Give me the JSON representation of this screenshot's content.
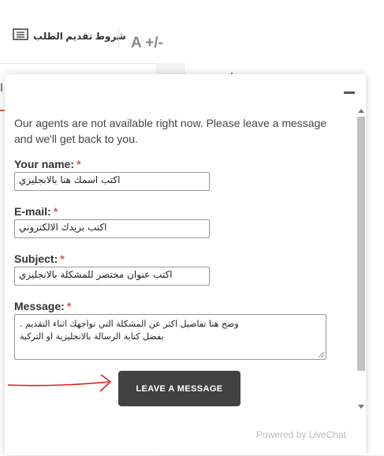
{
  "header": {
    "terms_label": "شروط تقديم الطلب",
    "font_size_label": "A +/-"
  },
  "background": {
    "left_fragment": "ا"
  },
  "chat": {
    "notice": "Our agents are not available right now. Please leave a message and we'll get back to you.",
    "fields": {
      "name": {
        "label": "Your name:",
        "required_mark": "*",
        "value": "اكتب اسمك هنا بالانجليزي"
      },
      "email": {
        "label": "E-mail:",
        "required_mark": "*",
        "value": "اكتب بريدك الالكتروني"
      },
      "subject": {
        "label": "Subject:",
        "required_mark": "*",
        "value": "اكتب عنوان مختصر للمشكلة بالانجليزي"
      },
      "message": {
        "label": "Message:",
        "required_mark": "*",
        "line1": "وضح هنا تفاصيل اكثر عن المشكلة التي تواجهك اثناء التقديم .",
        "line2": "يفضل كتابة الرسالة بالانجليزية او التركية"
      }
    },
    "submit_label": "LEAVE A MESSAGE",
    "powered_by": "Powered by LiveChat"
  },
  "colors": {
    "accent_red": "#d9534f",
    "button_bg": "#424242",
    "arrow_red": "#e02020"
  },
  "icons": {
    "terms": "document-list-icon",
    "minimize": "minimize-icon"
  }
}
